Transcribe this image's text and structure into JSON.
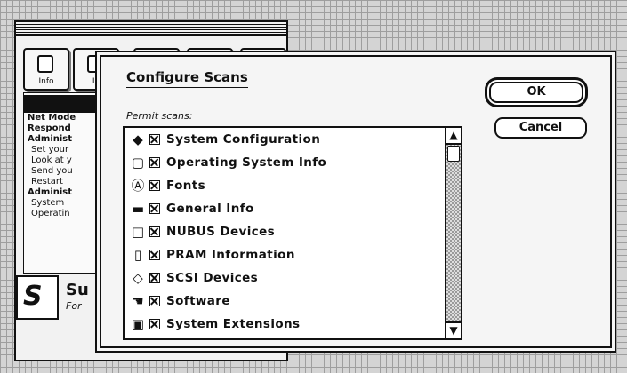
{
  "background_window": {
    "toolbar": [
      {
        "label": "Info",
        "icon": "info-icon"
      },
      {
        "label": "In",
        "icon": "document-icon"
      },
      {
        "label": "",
        "icon": "toolbar-icon"
      },
      {
        "label": "",
        "icon": "toolbar-icon"
      },
      {
        "label": "",
        "icon": "toolbar-icon"
      }
    ],
    "list": [
      {
        "text": "Net Mode",
        "bold": true
      },
      {
        "text": "Respond",
        "bold": true
      },
      {
        "text": "Administ",
        "bold": true
      },
      {
        "text": "Set your",
        "bold": false
      },
      {
        "text": "Look at y",
        "bold": false
      },
      {
        "text": "Send you",
        "bold": false
      },
      {
        "text": "Restart",
        "bold": false
      },
      {
        "text": "Administ",
        "bold": true
      },
      {
        "text": "System",
        "bold": false
      },
      {
        "text": "Operatin",
        "bold": false
      }
    ],
    "suite": {
      "name": "Su",
      "sub": "For"
    }
  },
  "dialog": {
    "title": "Configure Scans",
    "permit_label": "Permit scans:",
    "items": [
      {
        "label": "System Configuration",
        "icon": "diamond-icon",
        "glyph": "◆",
        "checked": true
      },
      {
        "label": "Operating System Info",
        "icon": "mac-icon",
        "glyph": "▢",
        "checked": true
      },
      {
        "label": "Fonts",
        "icon": "fonts-icon",
        "glyph": "Ⓐ",
        "checked": true
      },
      {
        "label": "General Info",
        "icon": "computer-icon",
        "glyph": "▬",
        "checked": true
      },
      {
        "label": "NUBUS Devices",
        "icon": "card-icon",
        "glyph": "□",
        "checked": true
      },
      {
        "label": "PRAM Information",
        "icon": "battery-icon",
        "glyph": "▯",
        "checked": true
      },
      {
        "label": "SCSI Devices",
        "icon": "scsi-icon",
        "glyph": "◇",
        "checked": true
      },
      {
        "label": "Software",
        "icon": "hand-icon",
        "glyph": "☚",
        "checked": true
      },
      {
        "label": "System Extensions",
        "icon": "extension-icon",
        "glyph": "▣",
        "checked": true
      }
    ],
    "ok_label": "OK",
    "cancel_label": "Cancel"
  }
}
